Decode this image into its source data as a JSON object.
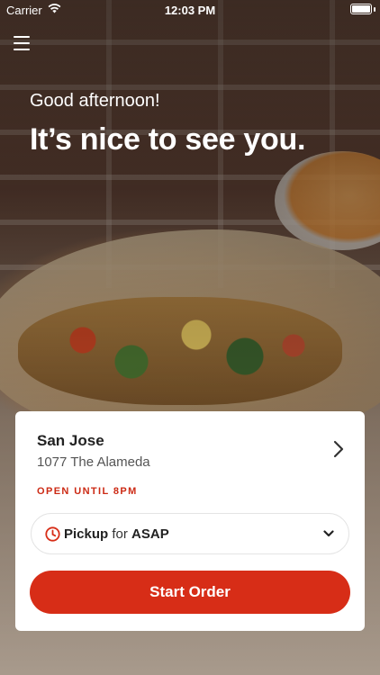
{
  "status_bar": {
    "carrier": "Carrier",
    "time": "12:03 PM",
    "wifi_icon": "wifi-icon",
    "battery_icon": "battery-icon"
  },
  "header": {
    "menu_icon": "hamburger-menu-icon",
    "greeting": "Good afternoon!",
    "headline": "It’s nice to see you."
  },
  "location_card": {
    "store_name": "San Jose",
    "store_address": "1077 The Alameda",
    "hours_status": "OPEN UNTIL 8PM",
    "pickup": {
      "mode": "Pickup",
      "connector": "for",
      "time": "ASAP",
      "icon": "clock-icon"
    },
    "start_order_label": "Start Order"
  },
  "colors": {
    "accent": "#d72d17",
    "hours_text": "#cc2a14",
    "card_background": "#ffffff"
  }
}
